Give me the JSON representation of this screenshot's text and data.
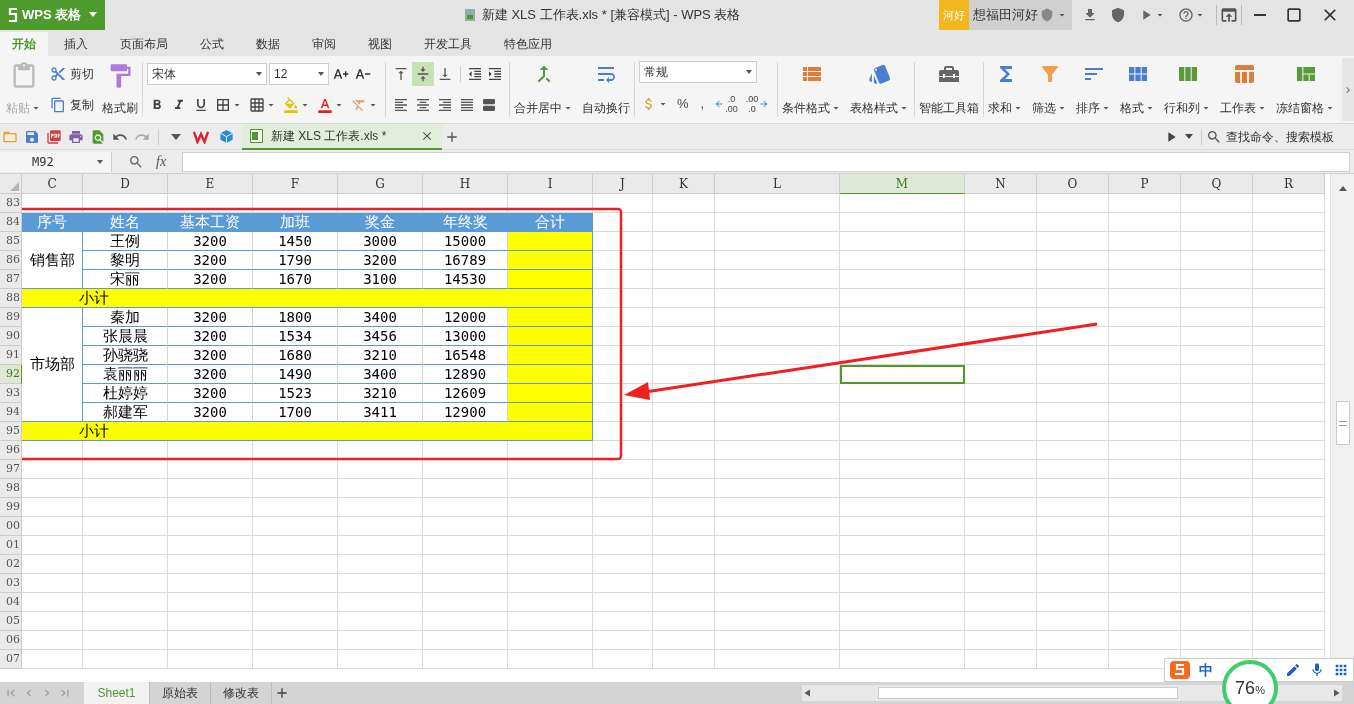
{
  "app_button": {
    "label": "WPS 表格"
  },
  "window": {
    "title": "新建 XLS 工作表.xls * [兼容模式] - WPS 表格"
  },
  "account": {
    "badge": "河好",
    "user": "想福田河好"
  },
  "menu_tabs": [
    {
      "label": "开始",
      "selected": true
    },
    {
      "label": "插入",
      "selected": false
    },
    {
      "label": "页面布局",
      "selected": false
    },
    {
      "label": "公式",
      "selected": false
    },
    {
      "label": "数据",
      "selected": false
    },
    {
      "label": "审阅",
      "selected": false
    },
    {
      "label": "视图",
      "selected": false
    },
    {
      "label": "开发工具",
      "selected": false
    },
    {
      "label": "特色应用",
      "selected": false
    }
  ],
  "clipboard": [
    {
      "kind": "paste",
      "label": "粘贴",
      "disabled": true
    },
    {
      "kind": "cut",
      "label": "剪切",
      "disabled": false
    },
    {
      "kind": "copy",
      "label": "复制",
      "disabled": false
    },
    {
      "kind": "painter",
      "label": "格式刷",
      "disabled": false
    }
  ],
  "font": {
    "name": "宋体",
    "size": "12"
  },
  "alignment": [
    {
      "kind": "top",
      "selected": false
    },
    {
      "kind": "middle",
      "selected": true
    },
    {
      "kind": "bottom",
      "selected": false
    },
    {
      "kind": "left",
      "selected": false
    },
    {
      "kind": "center",
      "selected": false
    },
    {
      "kind": "right",
      "selected": false
    },
    {
      "kind": "justify",
      "selected": false
    },
    {
      "kind": "distribute",
      "selected": false
    }
  ],
  "number_format": "常规",
  "number_buttons": [
    {
      "kind": "currency"
    },
    {
      "kind": "percent",
      "label": "%"
    },
    {
      "kind": "comma",
      "label": ","
    },
    {
      "kind": "decimal-up",
      "lines": [
        ".0",
        ".00"
      ]
    },
    {
      "kind": "decimal-down",
      "lines": [
        ".00",
        ".0"
      ]
    }
  ],
  "big_buttons": [
    {
      "kind": "merge",
      "label": "合并居中",
      "dropdown": true
    },
    {
      "kind": "wrap",
      "label": "自动换行",
      "dropdown": false
    },
    {
      "kind": "conditional",
      "label": "条件格式",
      "dropdown": true
    },
    {
      "kind": "style",
      "label": "表格样式",
      "dropdown": true
    },
    {
      "kind": "toolbox",
      "label": "智能工具箱",
      "dropdown": false
    },
    {
      "kind": "sum",
      "label": "求和",
      "dropdown": true
    },
    {
      "kind": "filter",
      "label": "筛选",
      "dropdown": true
    },
    {
      "kind": "sort",
      "label": "排序",
      "dropdown": true
    },
    {
      "kind": "format",
      "label": "格式",
      "dropdown": true
    },
    {
      "kind": "rowcol",
      "label": "行和列",
      "dropdown": true
    },
    {
      "kind": "sheet",
      "label": "工作表",
      "dropdown": true
    },
    {
      "kind": "freeze",
      "label": "冻结窗格",
      "dropdown": true
    }
  ],
  "document_tab": {
    "label": "新建 XLS 工作表.xls *"
  },
  "command_search": {
    "placeholder": "查找命令、搜索模板"
  },
  "formula_bar": {
    "name_box": "M92",
    "fx": "fx"
  },
  "sheet": {
    "columns": [
      {
        "label": "C",
        "selected": false
      },
      {
        "label": "D",
        "selected": false
      },
      {
        "label": "E",
        "selected": false
      },
      {
        "label": "F",
        "selected": false
      },
      {
        "label": "G",
        "selected": false
      },
      {
        "label": "H",
        "selected": false
      },
      {
        "label": "I",
        "selected": false
      },
      {
        "label": "J",
        "selected": false
      },
      {
        "label": "K",
        "selected": false
      },
      {
        "label": "L",
        "selected": false
      },
      {
        "label": "M",
        "selected": true
      },
      {
        "label": "N",
        "selected": false
      },
      {
        "label": "O",
        "selected": false
      },
      {
        "label": "P",
        "selected": false
      },
      {
        "label": "Q",
        "selected": false
      },
      {
        "label": "R",
        "selected": false
      }
    ],
    "rows": [
      {
        "label": "83",
        "selected": false
      },
      {
        "label": "84",
        "selected": false
      },
      {
        "label": "85",
        "selected": false
      },
      {
        "label": "86",
        "selected": false
      },
      {
        "label": "87",
        "selected": false
      },
      {
        "label": "88",
        "selected": false
      },
      {
        "label": "89",
        "selected": false
      },
      {
        "label": "90",
        "selected": false
      },
      {
        "label": "91",
        "selected": false
      },
      {
        "label": "92",
        "selected": true
      },
      {
        "label": "93",
        "selected": false
      },
      {
        "label": "94",
        "selected": false
      },
      {
        "label": "95",
        "selected": false
      },
      {
        "label": "96",
        "selected": false
      },
      {
        "label": "97",
        "selected": false
      },
      {
        "label": "98",
        "selected": false
      },
      {
        "label": "99",
        "selected": false
      },
      {
        "label": "00",
        "selected": false
      },
      {
        "label": "01",
        "selected": false
      },
      {
        "label": "02",
        "selected": false
      },
      {
        "label": "03",
        "selected": false
      },
      {
        "label": "04",
        "selected": false
      },
      {
        "label": "05",
        "selected": false
      },
      {
        "label": "06",
        "selected": false
      },
      {
        "label": "07",
        "selected": false
      }
    ]
  },
  "table": {
    "columns": [
      "序号",
      "姓名",
      "基本工资",
      "加班",
      "奖金",
      "年终奖",
      "合计"
    ],
    "groups": [
      {
        "department": "销售部",
        "subtotal": "小计",
        "rows": [
          {
            "name": "王例",
            "values": [
              "3200",
              "1450",
              "3000",
              "15000"
            ]
          },
          {
            "name": "黎明",
            "values": [
              "3200",
              "1790",
              "3200",
              "16789"
            ]
          },
          {
            "name": "宋丽",
            "values": [
              "3200",
              "1670",
              "3100",
              "14530"
            ]
          }
        ]
      },
      {
        "department": "市场部",
        "subtotal": "小计",
        "rows": [
          {
            "name": "秦加",
            "values": [
              "3200",
              "1800",
              "3400",
              "12000"
            ]
          },
          {
            "name": "张晨晨",
            "values": [
              "3200",
              "1534",
              "3456",
              "13000"
            ]
          },
          {
            "name": "孙骁骁",
            "values": [
              "3200",
              "1680",
              "3210",
              "16548"
            ]
          },
          {
            "name": "袁丽丽",
            "values": [
              "3200",
              "1490",
              "3400",
              "12890"
            ]
          },
          {
            "name": "杜婷婷",
            "values": [
              "3200",
              "1523",
              "3210",
              "12609"
            ]
          },
          {
            "name": "郝建军",
            "values": [
              "3200",
              "1700",
              "3411",
              "12900"
            ]
          }
        ]
      }
    ]
  },
  "sheet_tabs": [
    {
      "label": "Sheet1",
      "selected": true
    },
    {
      "label": "原始表",
      "selected": false
    },
    {
      "label": "修改表",
      "selected": false
    }
  ],
  "ime_bar": {
    "mode": "中"
  },
  "speed_widget": {
    "reading": "76",
    "unit": "%"
  }
}
